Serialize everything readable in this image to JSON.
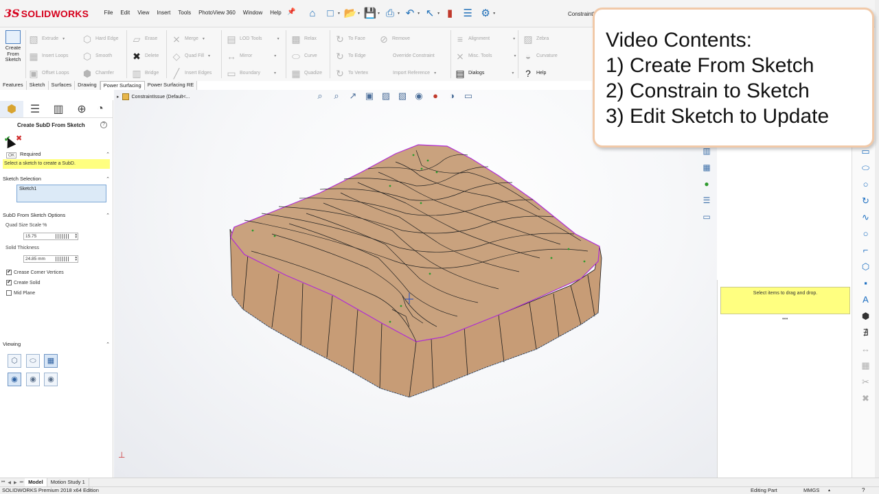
{
  "app": {
    "brand_mark": "3S",
    "brand_name": "SOLIDWORKS",
    "document_title": "ConstraintIss"
  },
  "menu": [
    "File",
    "Edit",
    "View",
    "Insert",
    "Tools",
    "PhotoView 360",
    "Window",
    "Help"
  ],
  "quick_access_icons": [
    "home-icon",
    "new-icon",
    "open-icon",
    "save-icon",
    "print-icon",
    "undo-icon",
    "select-icon",
    "rebuild-icon",
    "file-properties-icon",
    "options-icon"
  ],
  "command_manager": {
    "create_from_sketch": "Create From Sketch",
    "groups": [
      [
        "Extrude",
        "Insert Loops",
        "Offset Loops"
      ],
      [
        "Hard Edge",
        "Smooth",
        "Chamfer"
      ],
      [
        "Erase",
        "Delete",
        "Bridge"
      ],
      [
        "Merge",
        "Quad Fill",
        "Insert Edges"
      ],
      [
        "LOD Tools",
        "Mirror",
        "Boundary"
      ],
      [
        "Relax",
        "Curve",
        "Quadize"
      ],
      [
        "To Face",
        "To Edge",
        "To Vertex"
      ],
      [
        "Remove",
        "Override Constraint",
        "Import Reference"
      ],
      [
        "Alignment",
        "Misc. Tools",
        "Dialogs"
      ],
      [
        "Zebra",
        "Curvature",
        "Help"
      ]
    ]
  },
  "tabs": [
    "Features",
    "Sketch",
    "Surfaces",
    "Drawing",
    "Power Surfacing",
    "Power Surfacing RE"
  ],
  "active_tab": "Power Surfacing",
  "property_manager": {
    "title": "Create SubD From Sketch",
    "ok_tooltip": "OK",
    "message_header": "Required",
    "message_text": "Select a sketch to create a SubD.",
    "sketch_selection_header": "Sketch Selection",
    "sketch_selection_value": "Sketch1",
    "options_header": "SubD From Sketch Options",
    "quad_size_label": "Quad Size Scale %",
    "quad_size_value": "15.75",
    "solid_thickness_label": "Solid Thickness",
    "solid_thickness_value": "24.85 mm",
    "crease_corner_label": "Crease Corner Vertices",
    "crease_corner_checked": true,
    "create_solid_label": "Create Solid",
    "create_solid_checked": true,
    "mid_plane_label": "Mid Plane",
    "mid_plane_checked": false,
    "viewing_header": "Viewing"
  },
  "graphics": {
    "tree_item": "ConstraintIssue  (Default<..."
  },
  "overlay": {
    "title": "Video Contents:",
    "items": [
      "1) Create From Sketch",
      "2) Constrain to Sketch",
      "3) Edit Sketch to Update"
    ]
  },
  "task_pane": {
    "drag_drop_message": "Select items to drag and drop."
  },
  "model_tabs": [
    "Model",
    "Motion Study 1"
  ],
  "status": {
    "left": "SOLIDWORKS Premium 2018 x64 Edition",
    "mode": "Editing Part",
    "units": "MMGS"
  },
  "colors": {
    "brand_red": "#d6001c",
    "model_face": "#c9a27e",
    "sketch_magenta": "#b02bd6",
    "highlight_yellow": "#ffff80",
    "overlay_border": "#f1c9a8"
  }
}
